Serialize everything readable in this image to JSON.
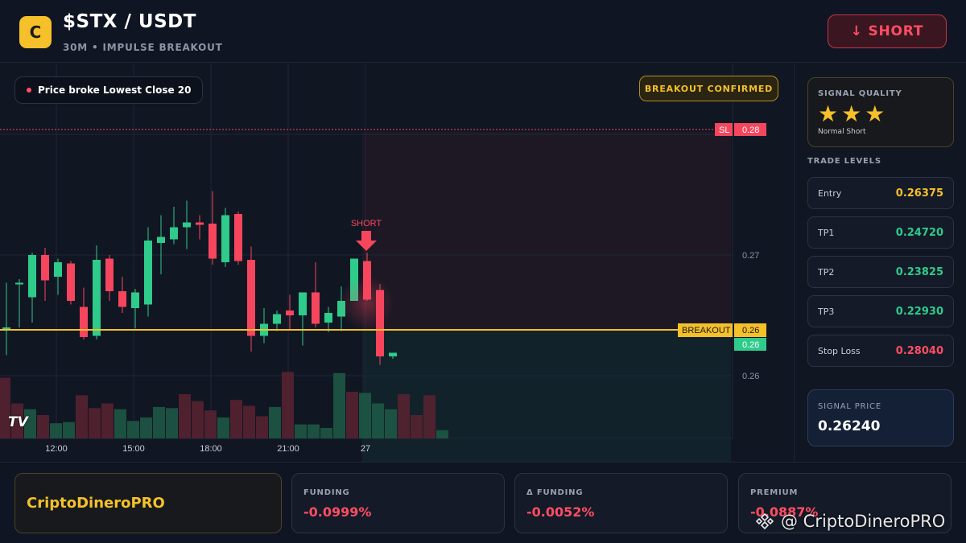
{
  "header": {
    "logo_letter": "C",
    "pair": "$STX / USDT",
    "subtitle": "30M • IMPULSE BREAKOUT",
    "action_label": "↓ SHORT"
  },
  "chart": {
    "signal_pill": "Price broke Lowest Close 20",
    "confirmed_badge": "BREAKOUT CONFIRMED",
    "tv_logo": "TV",
    "short_marker": "SHORT",
    "sl_tag": "SL",
    "sl_price_tag": "0.28",
    "breakout_tag": "BREAKOUT",
    "breakout_price_tag": "0.26",
    "last_price_tag": "0.26",
    "price_axis": [
      "0.27",
      "0.26"
    ],
    "time_axis": [
      "12:00",
      "15:00",
      "18:00",
      "21:00",
      "27"
    ],
    "candles": [
      {
        "o": 0.264,
        "h": 0.2677,
        "l": 0.2617,
        "c": 0.264
      },
      {
        "o": 0.2677,
        "h": 0.268,
        "l": 0.264,
        "c": 0.2677
      },
      {
        "o": 0.2665,
        "h": 0.2702,
        "l": 0.2644,
        "c": 0.27
      },
      {
        "o": 0.27,
        "h": 0.2706,
        "l": 0.2662,
        "c": 0.2679
      },
      {
        "o": 0.2682,
        "h": 0.2697,
        "l": 0.2667,
        "c": 0.2694
      },
      {
        "o": 0.2693,
        "h": 0.2695,
        "l": 0.2659,
        "c": 0.2662
      },
      {
        "o": 0.2657,
        "h": 0.2673,
        "l": 0.263,
        "c": 0.2632
      },
      {
        "o": 0.2633,
        "h": 0.2708,
        "l": 0.263,
        "c": 0.2696
      },
      {
        "o": 0.2697,
        "h": 0.27,
        "l": 0.2662,
        "c": 0.267
      },
      {
        "o": 0.267,
        "h": 0.2682,
        "l": 0.2652,
        "c": 0.2657
      },
      {
        "o": 0.2656,
        "h": 0.2672,
        "l": 0.2639,
        "c": 0.2669
      },
      {
        "o": 0.2659,
        "h": 0.2723,
        "l": 0.2649,
        "c": 0.2712
      },
      {
        "o": 0.271,
        "h": 0.2733,
        "l": 0.2684,
        "c": 0.2715
      },
      {
        "o": 0.2713,
        "h": 0.274,
        "l": 0.2709,
        "c": 0.2723
      },
      {
        "o": 0.2723,
        "h": 0.2745,
        "l": 0.2705,
        "c": 0.2727
      },
      {
        "o": 0.2727,
        "h": 0.2733,
        "l": 0.2713,
        "c": 0.2725
      },
      {
        "o": 0.2726,
        "h": 0.2753,
        "l": 0.2692,
        "c": 0.2697
      },
      {
        "o": 0.2694,
        "h": 0.2739,
        "l": 0.269,
        "c": 0.2733
      },
      {
        "o": 0.2734,
        "h": 0.2736,
        "l": 0.2692,
        "c": 0.2695
      },
      {
        "o": 0.2696,
        "h": 0.2707,
        "l": 0.262,
        "c": 0.2633
      },
      {
        "o": 0.2633,
        "h": 0.2656,
        "l": 0.2627,
        "c": 0.2643
      },
      {
        "o": 0.2643,
        "h": 0.2654,
        "l": 0.2637,
        "c": 0.2651
      },
      {
        "o": 0.2654,
        "h": 0.2667,
        "l": 0.2638,
        "c": 0.265
      },
      {
        "o": 0.265,
        "h": 0.2668,
        "l": 0.2625,
        "c": 0.2669
      },
      {
        "o": 0.2669,
        "h": 0.2694,
        "l": 0.264,
        "c": 0.2643
      },
      {
        "o": 0.2644,
        "h": 0.2657,
        "l": 0.2636,
        "c": 0.2652
      },
      {
        "o": 0.2649,
        "h": 0.2674,
        "l": 0.2637,
        "c": 0.2662
      },
      {
        "o": 0.2662,
        "h": 0.2697,
        "l": 0.2662,
        "c": 0.2697
      },
      {
        "o": 0.2695,
        "h": 0.2702,
        "l": 0.2662,
        "c": 0.2663
      },
      {
        "o": 0.2671,
        "h": 0.2676,
        "l": 0.2609,
        "c": 0.2616
      },
      {
        "o": 0.2616,
        "h": 0.2619,
        "l": 0.2614,
        "c": 0.2619
      }
    ],
    "volumes": [
      52,
      30,
      25,
      20,
      13,
      14,
      37,
      26,
      30,
      25,
      15,
      18,
      27,
      26,
      38,
      32,
      24,
      18,
      33,
      28,
      19,
      27,
      57,
      12,
      12,
      9,
      56,
      40,
      39,
      30,
      25,
      38,
      20,
      37,
      7
    ],
    "volume_up": [
      false,
      false,
      true,
      false,
      true,
      true,
      false,
      false,
      false,
      true,
      true,
      true,
      true,
      true,
      false,
      false,
      false,
      true,
      false,
      false,
      false,
      true,
      false,
      true,
      true,
      true,
      true,
      false,
      true,
      true,
      true,
      false,
      false,
      false,
      true
    ],
    "colors": {
      "up": "#2ecb8b",
      "down": "#f6465d",
      "breakout": "#f5c02a",
      "sl": "#f6465d"
    }
  },
  "sidebar": {
    "quality_title": "SIGNAL QUALITY",
    "stars": "★★★",
    "quality_note": "Normal Short",
    "levels_title": "TRADE LEVELS",
    "levels": [
      {
        "label": "Entry",
        "value": "0.26375",
        "color": "#f5c02a"
      },
      {
        "label": "TP1",
        "value": "0.24720",
        "color": "#2ecb8b"
      },
      {
        "label": "TP2",
        "value": "0.23825",
        "color": "#2ecb8b"
      },
      {
        "label": "TP3",
        "value": "0.22930",
        "color": "#2ecb8b"
      },
      {
        "label": "Stop Loss",
        "value": "0.28040",
        "color": "#ff4d63"
      }
    ],
    "signal_price_label": "SIGNAL PRICE",
    "signal_price": "0.26240"
  },
  "bottom": {
    "brand": "CriptoDineroPRO",
    "metrics": [
      {
        "label": "FUNDING",
        "value": "-0.0999%"
      },
      {
        "label": "Δ FUNDING",
        "value": "-0.0052%"
      },
      {
        "label": "PREMIUM",
        "value": "-0.0887%"
      }
    ],
    "watermark": "@ CriptoDineroPRO"
  }
}
